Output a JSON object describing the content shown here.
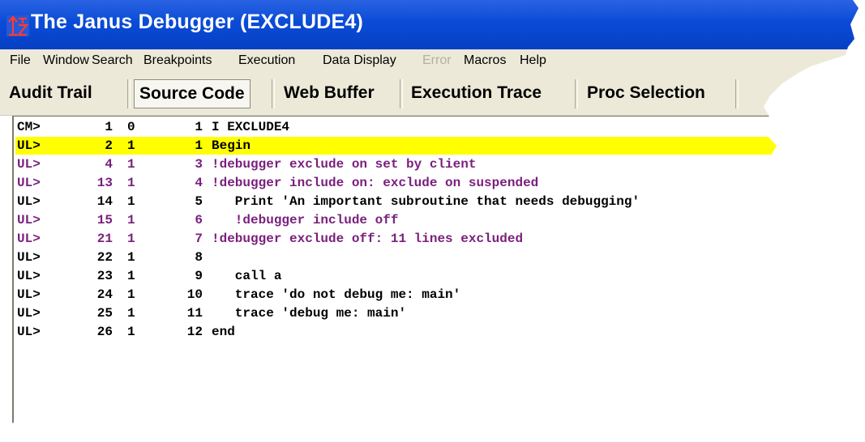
{
  "app": {
    "title": "The Janus Debugger (EXCLUDE4)",
    "icon": "janus-logo-icon"
  },
  "menu": [
    {
      "label": "File",
      "enabled": true
    },
    {
      "label": "Window",
      "enabled": true
    },
    {
      "label": "Search",
      "enabled": true
    },
    {
      "label": "Breakpoints",
      "enabled": true
    },
    {
      "label": "Execution",
      "enabled": true
    },
    {
      "label": "Data Display",
      "enabled": true
    },
    {
      "label": "Error",
      "enabled": false
    },
    {
      "label": "Macros",
      "enabled": true
    },
    {
      "label": "Help",
      "enabled": true
    }
  ],
  "tabs": [
    {
      "label": "Audit Trail",
      "active": false
    },
    {
      "label": "Source Code",
      "active": true
    },
    {
      "label": "Web Buffer",
      "active": false
    },
    {
      "label": "Execution Trace",
      "active": false
    },
    {
      "label": "Proc Selection",
      "active": false
    }
  ],
  "colors": {
    "current_line": "#ffff00",
    "excluded_text": "#7a1f7d",
    "normal_text": "#000000",
    "titlebar": "#0a4bd6"
  },
  "source_lines": [
    {
      "prefix": "CM>",
      "c1": "1",
      "c2": "0",
      "c3": "1",
      "text": "I EXCLUDE4",
      "style": "black"
    },
    {
      "prefix": "UL>",
      "c1": "2",
      "c2": "1",
      "c3": "1",
      "text": "Begin",
      "style": "current"
    },
    {
      "prefix": "UL>",
      "c1": "4",
      "c2": "1",
      "c3": "3",
      "text": "!debugger exclude on set by client",
      "style": "purple"
    },
    {
      "prefix": "UL>",
      "c1": "13",
      "c2": "1",
      "c3": "4",
      "text": "!debugger include on: exclude on suspended",
      "style": "purple"
    },
    {
      "prefix": "UL>",
      "c1": "14",
      "c2": "1",
      "c3": "5",
      "text": "   Print 'An important subroutine that needs debugging'",
      "style": "black"
    },
    {
      "prefix": "UL>",
      "c1": "15",
      "c2": "1",
      "c3": "6",
      "text": "   !debugger include off",
      "style": "purple"
    },
    {
      "prefix": "UL>",
      "c1": "21",
      "c2": "1",
      "c3": "7",
      "text": "!debugger exclude off: 11 lines excluded",
      "style": "purple"
    },
    {
      "prefix": "UL>",
      "c1": "22",
      "c2": "1",
      "c3": "8",
      "text": "",
      "style": "black"
    },
    {
      "prefix": "UL>",
      "c1": "23",
      "c2": "1",
      "c3": "9",
      "text": "   call a",
      "style": "black"
    },
    {
      "prefix": "UL>",
      "c1": "24",
      "c2": "1",
      "c3": "10",
      "text": "   trace 'do not debug me: main'",
      "style": "black"
    },
    {
      "prefix": "UL>",
      "c1": "25",
      "c2": "1",
      "c3": "11",
      "text": "   trace 'debug me: main'",
      "style": "black"
    },
    {
      "prefix": "UL>",
      "c1": "26",
      "c2": "1",
      "c3": "12",
      "text": "end",
      "style": "black"
    }
  ]
}
